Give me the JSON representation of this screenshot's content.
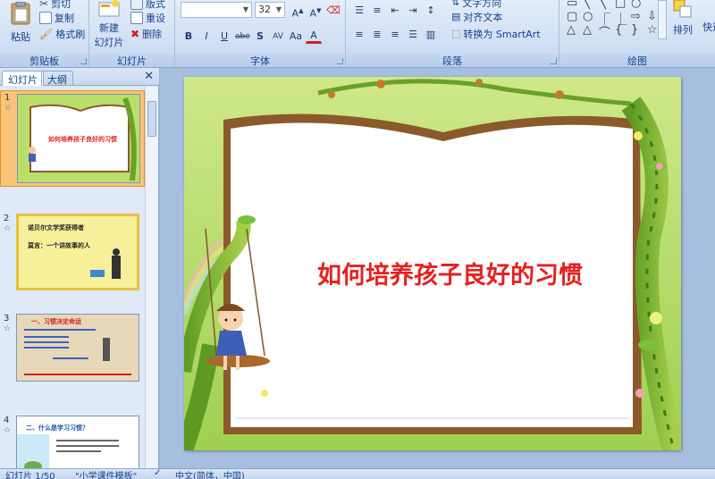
{
  "ribbon": {
    "clipboard": {
      "label": "剪贴板",
      "paste": "粘贴",
      "cut": "剪切",
      "copy": "复制",
      "format_painter": "格式刷"
    },
    "slides": {
      "label": "幻灯片",
      "new_slide": "新建",
      "new_slide_line2": "幻灯片",
      "layout": "版式",
      "reset": "重设",
      "delete": "删除"
    },
    "font": {
      "label": "字体",
      "font_name": "",
      "font_size": "32",
      "buttons": [
        "B",
        "I",
        "U",
        "abe",
        "S",
        "AV",
        "Aa",
        "A"
      ]
    },
    "paragraph": {
      "label": "段落",
      "text_direction": "文字方向",
      "align_text": "对齐文本",
      "convert_smartart": "转换为 SmartArt"
    },
    "drawing": {
      "label": "绘图",
      "arrange": "排列",
      "quick_styles": "快速"
    }
  },
  "left_pane": {
    "tab_slides": "幻灯片",
    "tab_outline": "大纲",
    "close": "✕",
    "thumbnails": [
      {
        "number": "1",
        "star": "☆",
        "title": "如何培养孩子良好的习惯"
      },
      {
        "number": "2",
        "star": "☆",
        "line1": "诺贝尔文学奖获得者",
        "line2": "莫言：一个讲故事的人"
      },
      {
        "number": "3",
        "star": "☆",
        "heading": "一、习惯决定命运"
      },
      {
        "number": "4",
        "star": "☆",
        "heading": "二、什么是学习习惯？"
      }
    ]
  },
  "slide": {
    "title": "如何培养孩子良好的习惯"
  },
  "status_bar": {
    "slide_info": "幻灯片 1/50",
    "theme": "\"小学课件模板\"",
    "language": "中文(简体，中国)"
  },
  "colors": {
    "title_red": "#e52020",
    "ribbon_bg": "#d3e1f4",
    "selected_thumb": "#f8c47a"
  }
}
